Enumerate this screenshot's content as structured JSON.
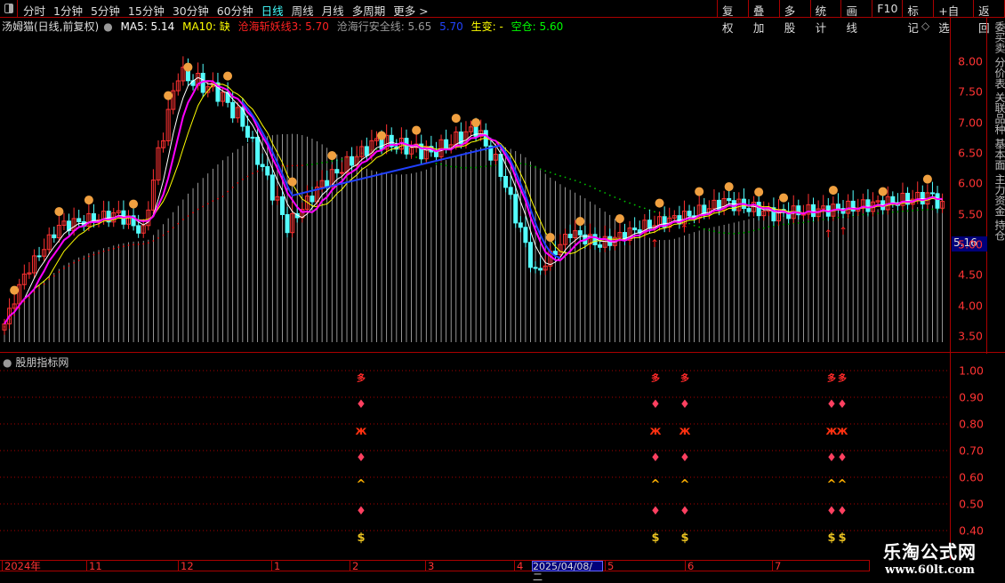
{
  "toolbar": {
    "periods": [
      "分时",
      "1分钟",
      "5分钟",
      "15分钟",
      "30分钟",
      "60分钟",
      "日线",
      "周线",
      "月线",
      "多周期",
      "更多 >"
    ],
    "active_period": "日线",
    "buttons": [
      "复权",
      "叠加",
      "多股",
      "统计",
      "画线",
      "F10",
      "标记",
      "+自选",
      "返回"
    ]
  },
  "legend": {
    "stock": "汤姆猫(日线,前复权)",
    "ma5": "MA5: 5.14",
    "ma10": "MA10: 缺",
    "line3": "沧海斩妖线3: 5.70",
    "safe": "沧海行安全线: 5.65",
    "blue": "5.70",
    "shengbian": "生变: -",
    "kongcang": "空仓: 5.60"
  },
  "colors": {
    "up": "#ff3232",
    "down": "#54ffff",
    "ma5": "#ffffff",
    "ma10": "#ffff00",
    "line3": "#ff00ff",
    "safe": "#c0c0c0",
    "blue": "#2040ff",
    "green_dots": "#00c000",
    "red_dots": "#ff2020"
  },
  "price_axis": {
    "labels": [
      "8.00",
      "7.50",
      "7.00",
      "6.50",
      "6.00",
      "5.50",
      "5.00",
      "4.50",
      "4.00",
      "3.50"
    ],
    "current": "5.16"
  },
  "chart_data": {
    "type": "candlestick",
    "ylim": [
      3.3,
      8.3
    ],
    "keypoints_bar_close": [
      [
        0,
        3.7
      ],
      [
        4,
        4.5
      ],
      [
        11,
        5.3
      ],
      [
        23,
        5.5
      ],
      [
        28,
        5.2
      ],
      [
        31,
        6.5
      ],
      [
        35,
        7.8
      ],
      [
        43,
        7.5
      ],
      [
        48,
        7.0
      ],
      [
        57,
        5.3
      ],
      [
        64,
        6.0
      ],
      [
        75,
        6.7
      ],
      [
        86,
        6.5
      ],
      [
        95,
        6.9
      ],
      [
        100,
        6.2
      ],
      [
        107,
        4.5
      ],
      [
        114,
        5.2
      ],
      [
        120,
        5.0
      ],
      [
        129,
        5.3
      ],
      [
        139,
        5.5
      ],
      [
        145,
        5.7
      ],
      [
        155,
        5.5
      ],
      [
        170,
        5.6
      ],
      [
        179,
        5.7
      ],
      [
        187,
        5.8
      ],
      [
        189,
        5.6
      ]
    ]
  },
  "sub": {
    "title": "股朋指标网",
    "axis": [
      "1.00",
      "0.90",
      "0.80",
      "0.70",
      "0.60",
      "0.50",
      "0.40"
    ],
    "signal_bars": [
      72,
      131,
      137,
      166,
      168
    ],
    "rows": [
      {
        "icon": "duo-icon",
        "glyph": "多",
        "color": "#ff2a2a"
      },
      {
        "icon": "gem-icon",
        "glyph": "♦",
        "color": "#ff4060"
      },
      {
        "icon": "butterfly-icon",
        "glyph": "ж",
        "color": "#ff3010"
      },
      {
        "icon": "gem-icon",
        "glyph": "♦",
        "color": "#ff4060"
      },
      {
        "icon": "up-arrow-icon",
        "glyph": "^",
        "color": "#ffb000"
      },
      {
        "icon": "gem-icon",
        "glyph": "♦",
        "color": "#ff4060"
      },
      {
        "icon": "money-bag-icon",
        "glyph": "$",
        "color": "#e8c020"
      }
    ]
  },
  "xaxis": {
    "labels": [
      "2024年",
      "11",
      "12",
      "1",
      "2",
      "3",
      "4",
      "5",
      "6",
      "7"
    ],
    "selected": "2025/04/08/二"
  },
  "side_tabs": "委买卖 分价表 关联品种 基本面 主力资金 持仓",
  "watermark": {
    "name": "乐淘公式网",
    "url": "www.60lt.com"
  }
}
